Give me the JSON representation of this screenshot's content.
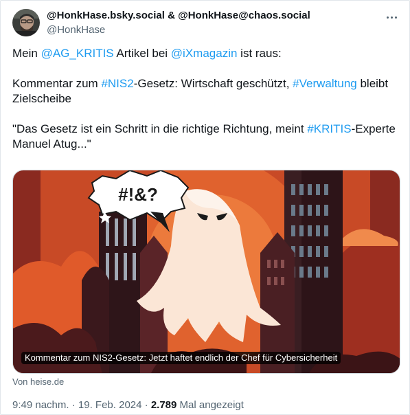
{
  "author": {
    "display_name": "@HonkHase.bsky.social & @HonkHase@chaos.social",
    "handle": "@HonkHase",
    "avatar_icon": "profile-photo"
  },
  "more_icon": "more-horizontal-icon",
  "tweet": {
    "line1": {
      "t1": "Mein ",
      "mention1": "@AG_KRITIS",
      "t2": " Artikel bei ",
      "mention2": "@iXmagazin",
      "t3": " ist raus:"
    },
    "line2": {
      "t1": "Kommentar zum ",
      "hashtag1": "#NIS2",
      "t2": "-Gesetz: Wirtschaft geschützt, ",
      "hashtag2": "#Verwaltung",
      "t3": " bleibt Zielscheibe"
    },
    "line3": {
      "t1": "\"Das Gesetz ist ein Schritt in die richtige Richtung, meint ",
      "hashtag1": "#KRITIS",
      "t2": "-Experte Manuel Atug...\""
    }
  },
  "card": {
    "speech_bubble_text": "#!&?",
    "caption": "Kommentar zum NIS2-Gesetz: Jetzt haftet endlich der Chef für Cybersicherheit",
    "source": "Von heise.de"
  },
  "meta": {
    "time": "9:49 nachm.",
    "sep1": " · ",
    "date": "19. Feb. 2024",
    "sep2": " · ",
    "views": "2.789",
    "views_label": " Mal angezeigt"
  },
  "colors": {
    "link": "#1d9bf0",
    "secondary_text": "#536471",
    "card_background": "#8a2a20",
    "card_sky": "#d5582c"
  }
}
